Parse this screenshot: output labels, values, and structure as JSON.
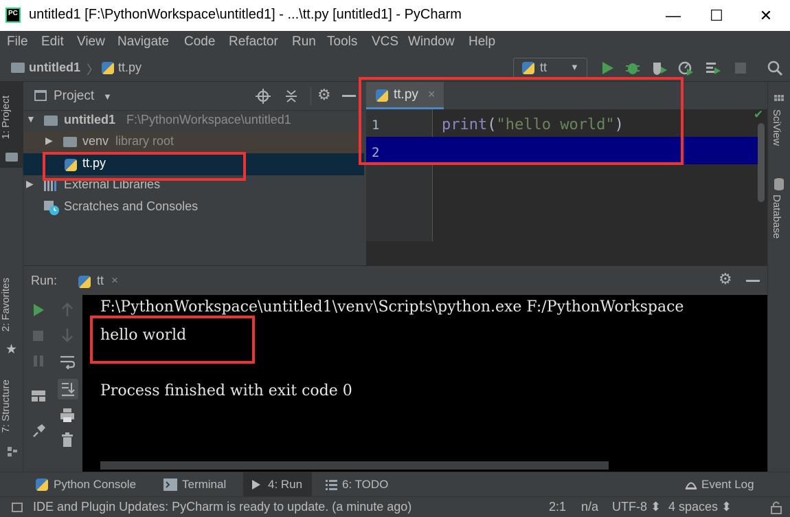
{
  "window": {
    "title": "untitled1 [F:\\PythonWorkspace\\untitled1] - ...\\tt.py [untitled1] - PyCharm",
    "logo_text": "PC",
    "minimize": "—",
    "maximize": "☐",
    "close": "✕"
  },
  "menu": [
    "File",
    "Edit",
    "View",
    "Navigate",
    "Code",
    "Refactor",
    "Run",
    "Tools",
    "VCS",
    "Window",
    "Help"
  ],
  "breadcrumb": {
    "project": "untitled1",
    "sep": "〉",
    "file": "tt.py"
  },
  "run_config": {
    "name": "tt",
    "arrow": "▼"
  },
  "left_tabs": {
    "project": "1: Project",
    "favorites": "2: Favorites",
    "structure": "7: Structure"
  },
  "project_panel": {
    "title": "Project",
    "dropdown": "▼",
    "rows": [
      {
        "arrow": "▼",
        "name": "untitled1",
        "path": "F:\\PythonWorkspace\\untitled1"
      },
      {
        "arrow": "▶",
        "name": "venv",
        "path": "library root"
      },
      {
        "arrow": "",
        "name": "tt.py",
        "path": ""
      },
      {
        "arrow": "▶",
        "name": "External Libraries",
        "path": ""
      },
      {
        "arrow": "",
        "name": "Scratches and Consoles",
        "path": ""
      }
    ]
  },
  "editor": {
    "tab_label": "tt.py",
    "tab_close": "×",
    "check": "✔",
    "lines": [
      {
        "num": "1",
        "func": "print",
        "open": "(",
        "string": "\"hello world\"",
        "close": ")"
      },
      {
        "num": "2",
        "func": "",
        "open": "",
        "string": "",
        "close": ""
      }
    ]
  },
  "right_tabs": {
    "sciview": "SciView",
    "database": "Database"
  },
  "run_panel": {
    "label": "Run:",
    "tab": "tt",
    "tab_close": "×",
    "console": [
      "F:\\PythonWorkspace\\untitled1\\venv\\Scripts\\python.exe F:/PythonWorkspace",
      "hello world",
      "",
      "Process finished with exit code 0"
    ]
  },
  "bottom_tabs": {
    "python_console": "Python Console",
    "terminal": "Terminal",
    "run": "4: Run",
    "todo": "6: TODO",
    "event_log": "Event Log"
  },
  "status": {
    "message": "IDE and Plugin Updates: PyCharm is ready to update. (a minute ago)",
    "position": "2:1",
    "na": "n/a",
    "encoding": "UTF-8 ⬍",
    "indent": "4 spaces ⬍"
  },
  "colors": {
    "highlight_box": "#ee3333",
    "selected_row": "#0d293e",
    "current_line": "#000080",
    "run_green": "#499c54"
  }
}
